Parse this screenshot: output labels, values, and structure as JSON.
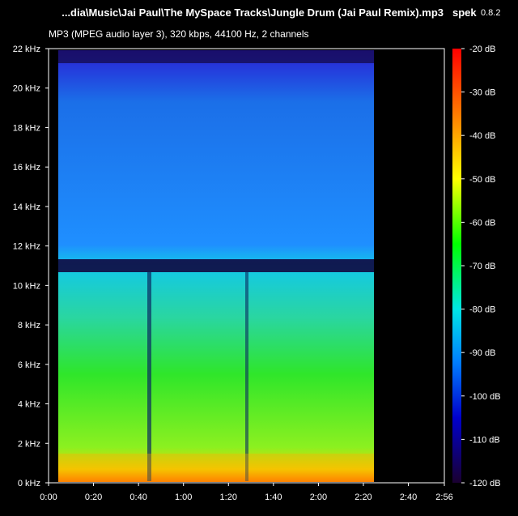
{
  "header": {
    "file_title": "...dia\\Music\\Jai Paul\\The MySpace Tracks\\Jungle Drum (Jai Paul Remix).mp3",
    "app_name": "spek",
    "app_version": "0.8.2",
    "info": "MP3 (MPEG audio layer 3), 320 kbps, 44100 Hz, 2 channels"
  },
  "frequency_axis": {
    "ticks": [
      "0 kHz",
      "2 kHz",
      "4 kHz",
      "6 kHz",
      "8 kHz",
      "10 kHz",
      "12 kHz",
      "14 kHz",
      "16 kHz",
      "18 kHz",
      "20 kHz",
      "22 kHz"
    ]
  },
  "time_axis": {
    "ticks": [
      "0:00",
      "0:20",
      "0:40",
      "1:00",
      "1:20",
      "1:40",
      "2:00",
      "2:20",
      "2:40",
      "2:56"
    ]
  },
  "db_scale": {
    "ticks": [
      "-20 dB",
      "-30 dB",
      "-40 dB",
      "-50 dB",
      "-60 dB",
      "-70 dB",
      "-80 dB",
      "-90 dB",
      "-100 dB",
      "-110 dB",
      "-120 dB"
    ],
    "colors": [
      "#ff0000",
      "#ff8000",
      "#ffff00",
      "#00ff00",
      "#00ffff",
      "#0080ff",
      "#0000ff",
      "#1a0033"
    ]
  }
}
